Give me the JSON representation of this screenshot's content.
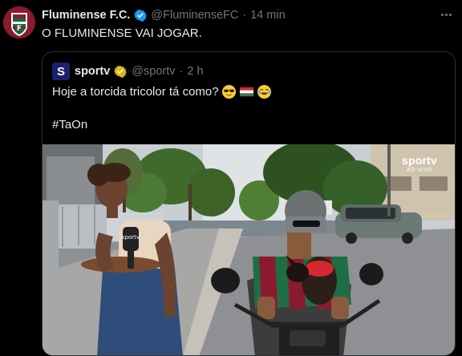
{
  "tweet": {
    "author_name": "Fluminense F.C.",
    "handle": "@FluminenseFC",
    "separator": "·",
    "time": "14 min",
    "text": "O FLUMINENSE VAI JOGAR."
  },
  "quote": {
    "logo_letter": "S",
    "author_name": "sportv",
    "handle": "@sportv",
    "separator": "·",
    "time": "2 h",
    "text": "Hoje a torcida tricolor tá como?",
    "emojis": [
      "sunglasses-emoji",
      "hungary-flag-emoji",
      "joy-emoji"
    ],
    "hashtag": "#TaOn",
    "media": {
      "watermark_logo": "sportv",
      "watermark_sub": "AO VIVO",
      "mic_label": "sportv"
    }
  },
  "colors": {
    "background": "#000000",
    "text": "#e7e9ea",
    "muted": "#71767b",
    "border": "#2f3336",
    "verified_blue": "#1d9bf0",
    "verified_gold": "#e2b719"
  }
}
